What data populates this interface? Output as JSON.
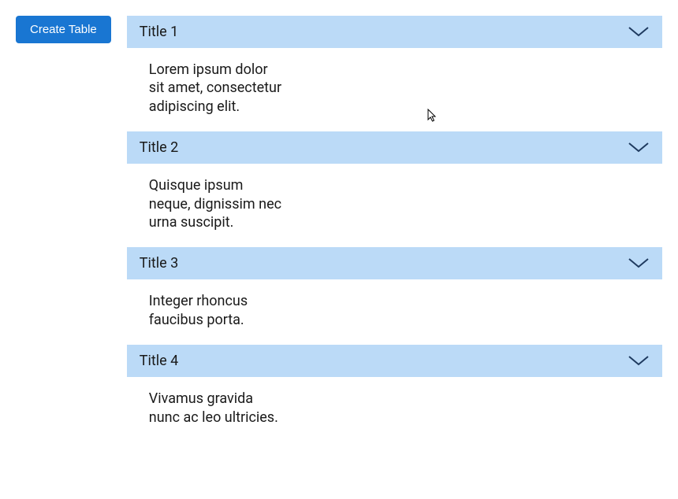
{
  "sidebar": {
    "create_button_label": "Create Table"
  },
  "accordion": {
    "items": [
      {
        "title": "Title 1",
        "content": "Lorem ipsum dolor sit amet, consectetur adipiscing elit."
      },
      {
        "title": "Title 2",
        "content": "Quisque ipsum neque, dignissim nec urna suscipit."
      },
      {
        "title": "Title 3",
        "content": "Integer rhoncus faucibus porta."
      },
      {
        "title": "Title 4",
        "content": "Vivamus gravida nunc ac leo ultricies."
      }
    ]
  },
  "colors": {
    "primary": "#1976d2",
    "accordion_bg": "#bbdaf7",
    "chevron": "#1e3a5f"
  }
}
